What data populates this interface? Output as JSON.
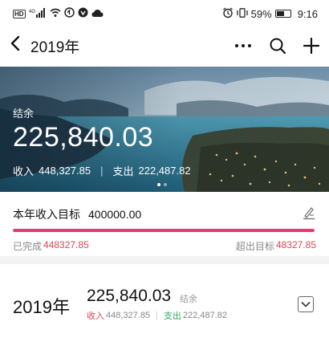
{
  "status_bar": {
    "hd_badge": "HD",
    "network": "4G",
    "battery_percent": "59%",
    "battery_level": 0.59,
    "time": "9:16"
  },
  "nav": {
    "title": "2019年",
    "icons": [
      "back-arrow-icon",
      "more-icon",
      "search-icon",
      "add-icon"
    ]
  },
  "hero": {
    "balance_label": "结余",
    "balance_amount": "225,840.03",
    "income_label": "收入",
    "income_amount": "448,327.85",
    "expense_label": "支出",
    "expense_amount": "222,487.82",
    "carousel_pages": 2,
    "carousel_active": 0
  },
  "goal": {
    "label": "本年收入目标",
    "value": "400000.00",
    "progress_fraction": 1.0,
    "completed_label": "已完成",
    "completed_value": "448327.85",
    "exceeded_label": "超出目标",
    "exceeded_value": "48327.85",
    "colors": {
      "progress": "#e8386d",
      "value_red": "#e0454d"
    }
  },
  "year_card": {
    "year": "2019年",
    "balance_amount": "225,840.03",
    "balance_label": "结余",
    "income_label": "收入",
    "income_amount": "448,327.85",
    "expense_label": "支出",
    "expense_amount": "222,487.82",
    "colors": {
      "income": "#e0454d",
      "expense": "#2eaa6a"
    }
  }
}
